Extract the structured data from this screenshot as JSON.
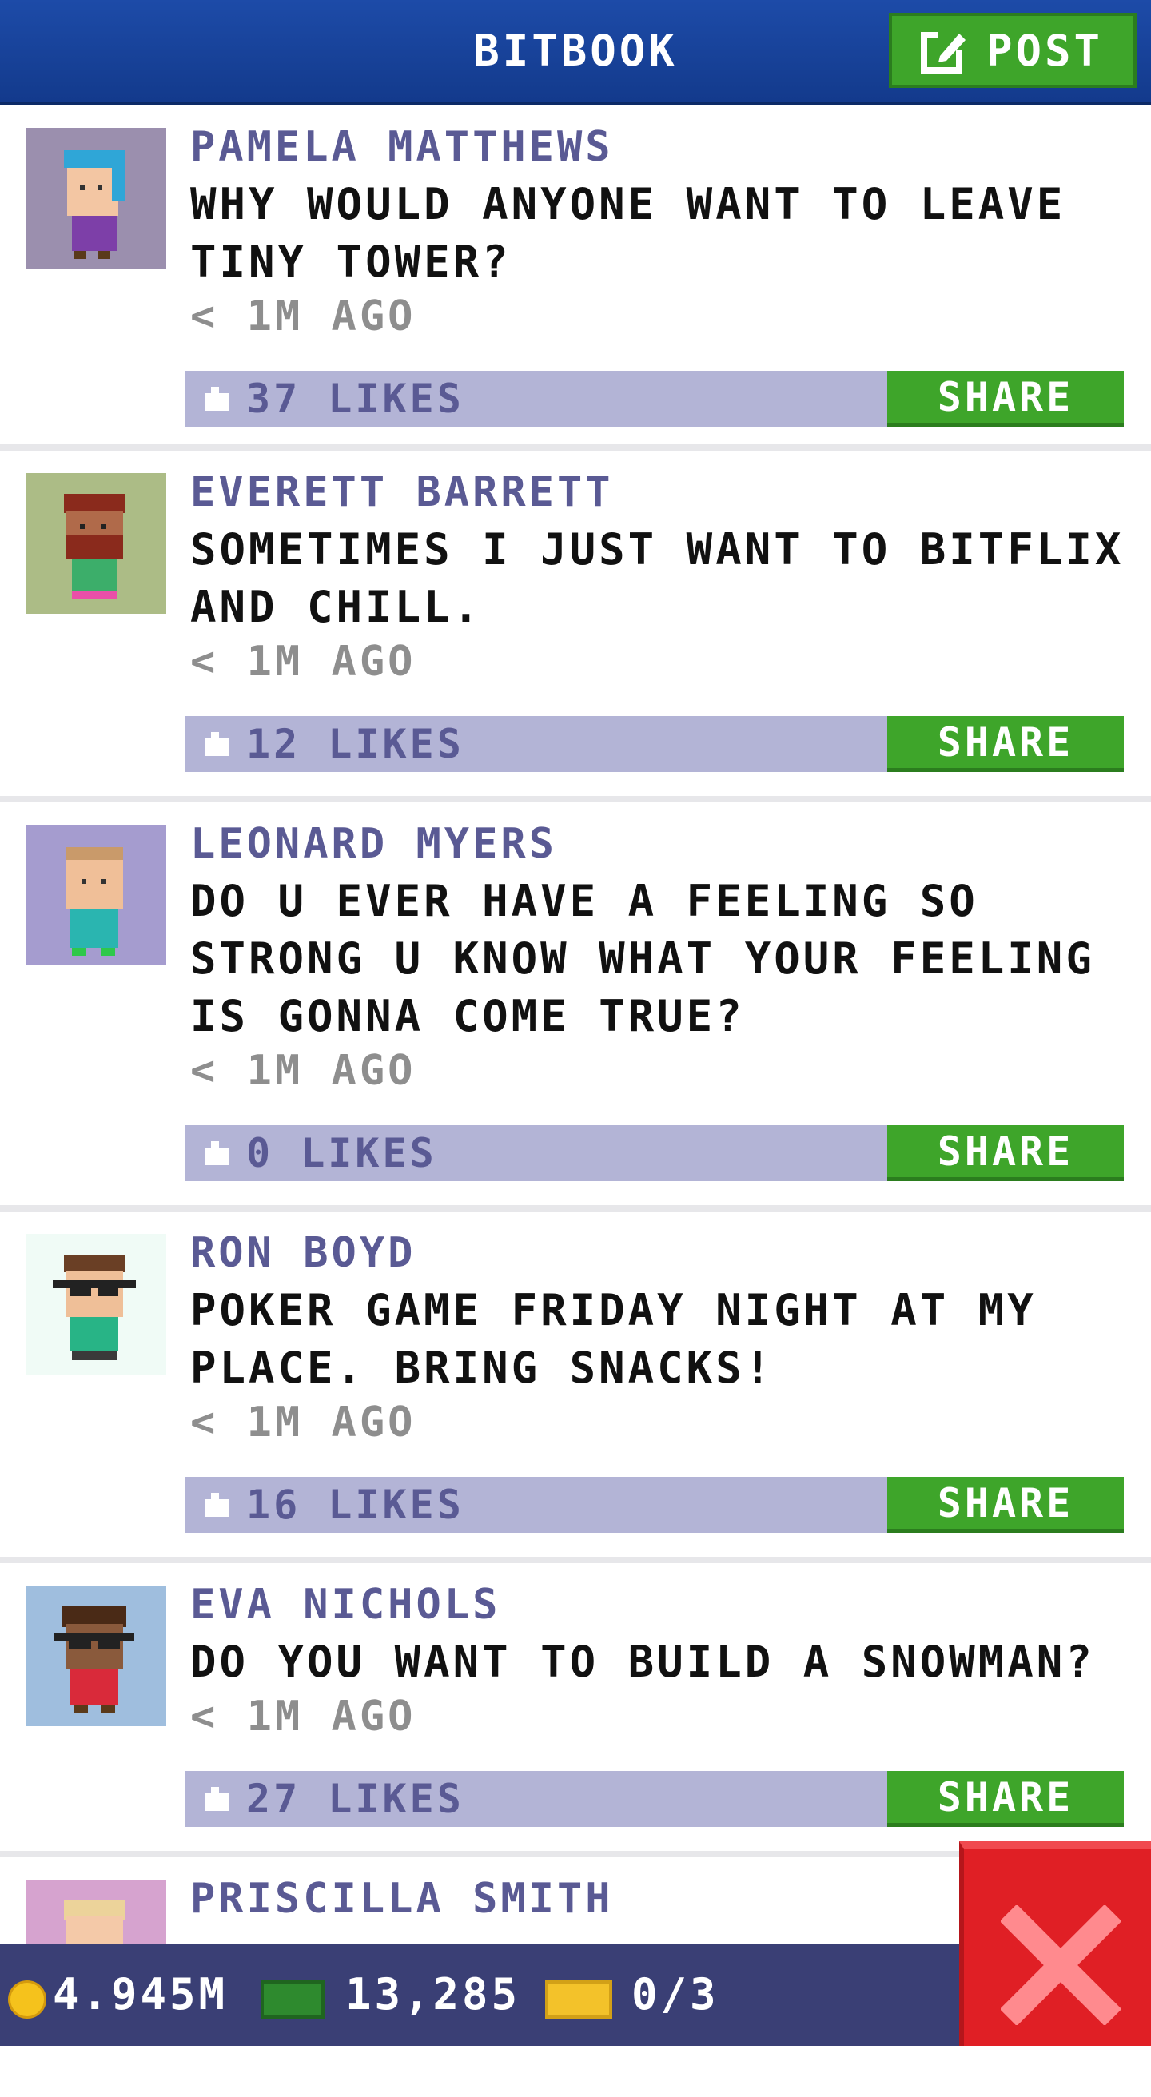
{
  "header": {
    "title": "BITBOOK",
    "post_label": "POST"
  },
  "posts": [
    {
      "name": "PAMELA MATTHEWS",
      "message": "WHY WOULD ANYONE WANT TO LEAVE TINY TOWER?",
      "time": "< 1M AGO",
      "likes": "37 LIKES",
      "share": "SHARE",
      "avatar_bg": "#9b8fae"
    },
    {
      "name": "EVERETT BARRETT",
      "message": "SOMETIMES I JUST WANT TO BITFLIX AND CHILL.",
      "time": "< 1M AGO",
      "likes": "12 LIKES",
      "share": "SHARE",
      "avatar_bg": "#acbc86"
    },
    {
      "name": "LEONARD MYERS",
      "message": "DO U EVER HAVE A FEELING SO STRONG U KNOW WHAT YOUR FEELING IS GONNA COME TRUE?",
      "time": "< 1M AGO",
      "likes": "0 LIKES",
      "share": "SHARE",
      "avatar_bg": "#a59ccf"
    },
    {
      "name": "RON BOYD",
      "message": "POKER GAME FRIDAY NIGHT AT MY PLACE. BRING SNACKS!",
      "time": "< 1M AGO",
      "likes": "16 LIKES",
      "share": "SHARE",
      "avatar_bg": "#f0fbf6"
    },
    {
      "name": "EVA NICHOLS",
      "message": "DO YOU WANT TO BUILD A SNOWMAN?",
      "time": "< 1M AGO",
      "likes": "27 LIKES",
      "share": "SHARE",
      "avatar_bg": "#9fbede"
    },
    {
      "name": "PRISCILLA SMITH",
      "avatar_bg": "#d6a3cf"
    }
  ],
  "status": {
    "coins": "4.945M",
    "bux": "13,285",
    "tickets": "0/3"
  },
  "colors": {
    "accent_blue": "#1d4ba8",
    "share_green": "#3ea52a",
    "like_bar": "#b3b4d6",
    "close_red": "#e01f25"
  },
  "icons": {
    "post": "edit-icon",
    "like": "thumbs-up-icon",
    "coin": "coin-icon",
    "bux": "bux-icon",
    "ticket": "ticket-icon",
    "close": "close-icon"
  }
}
